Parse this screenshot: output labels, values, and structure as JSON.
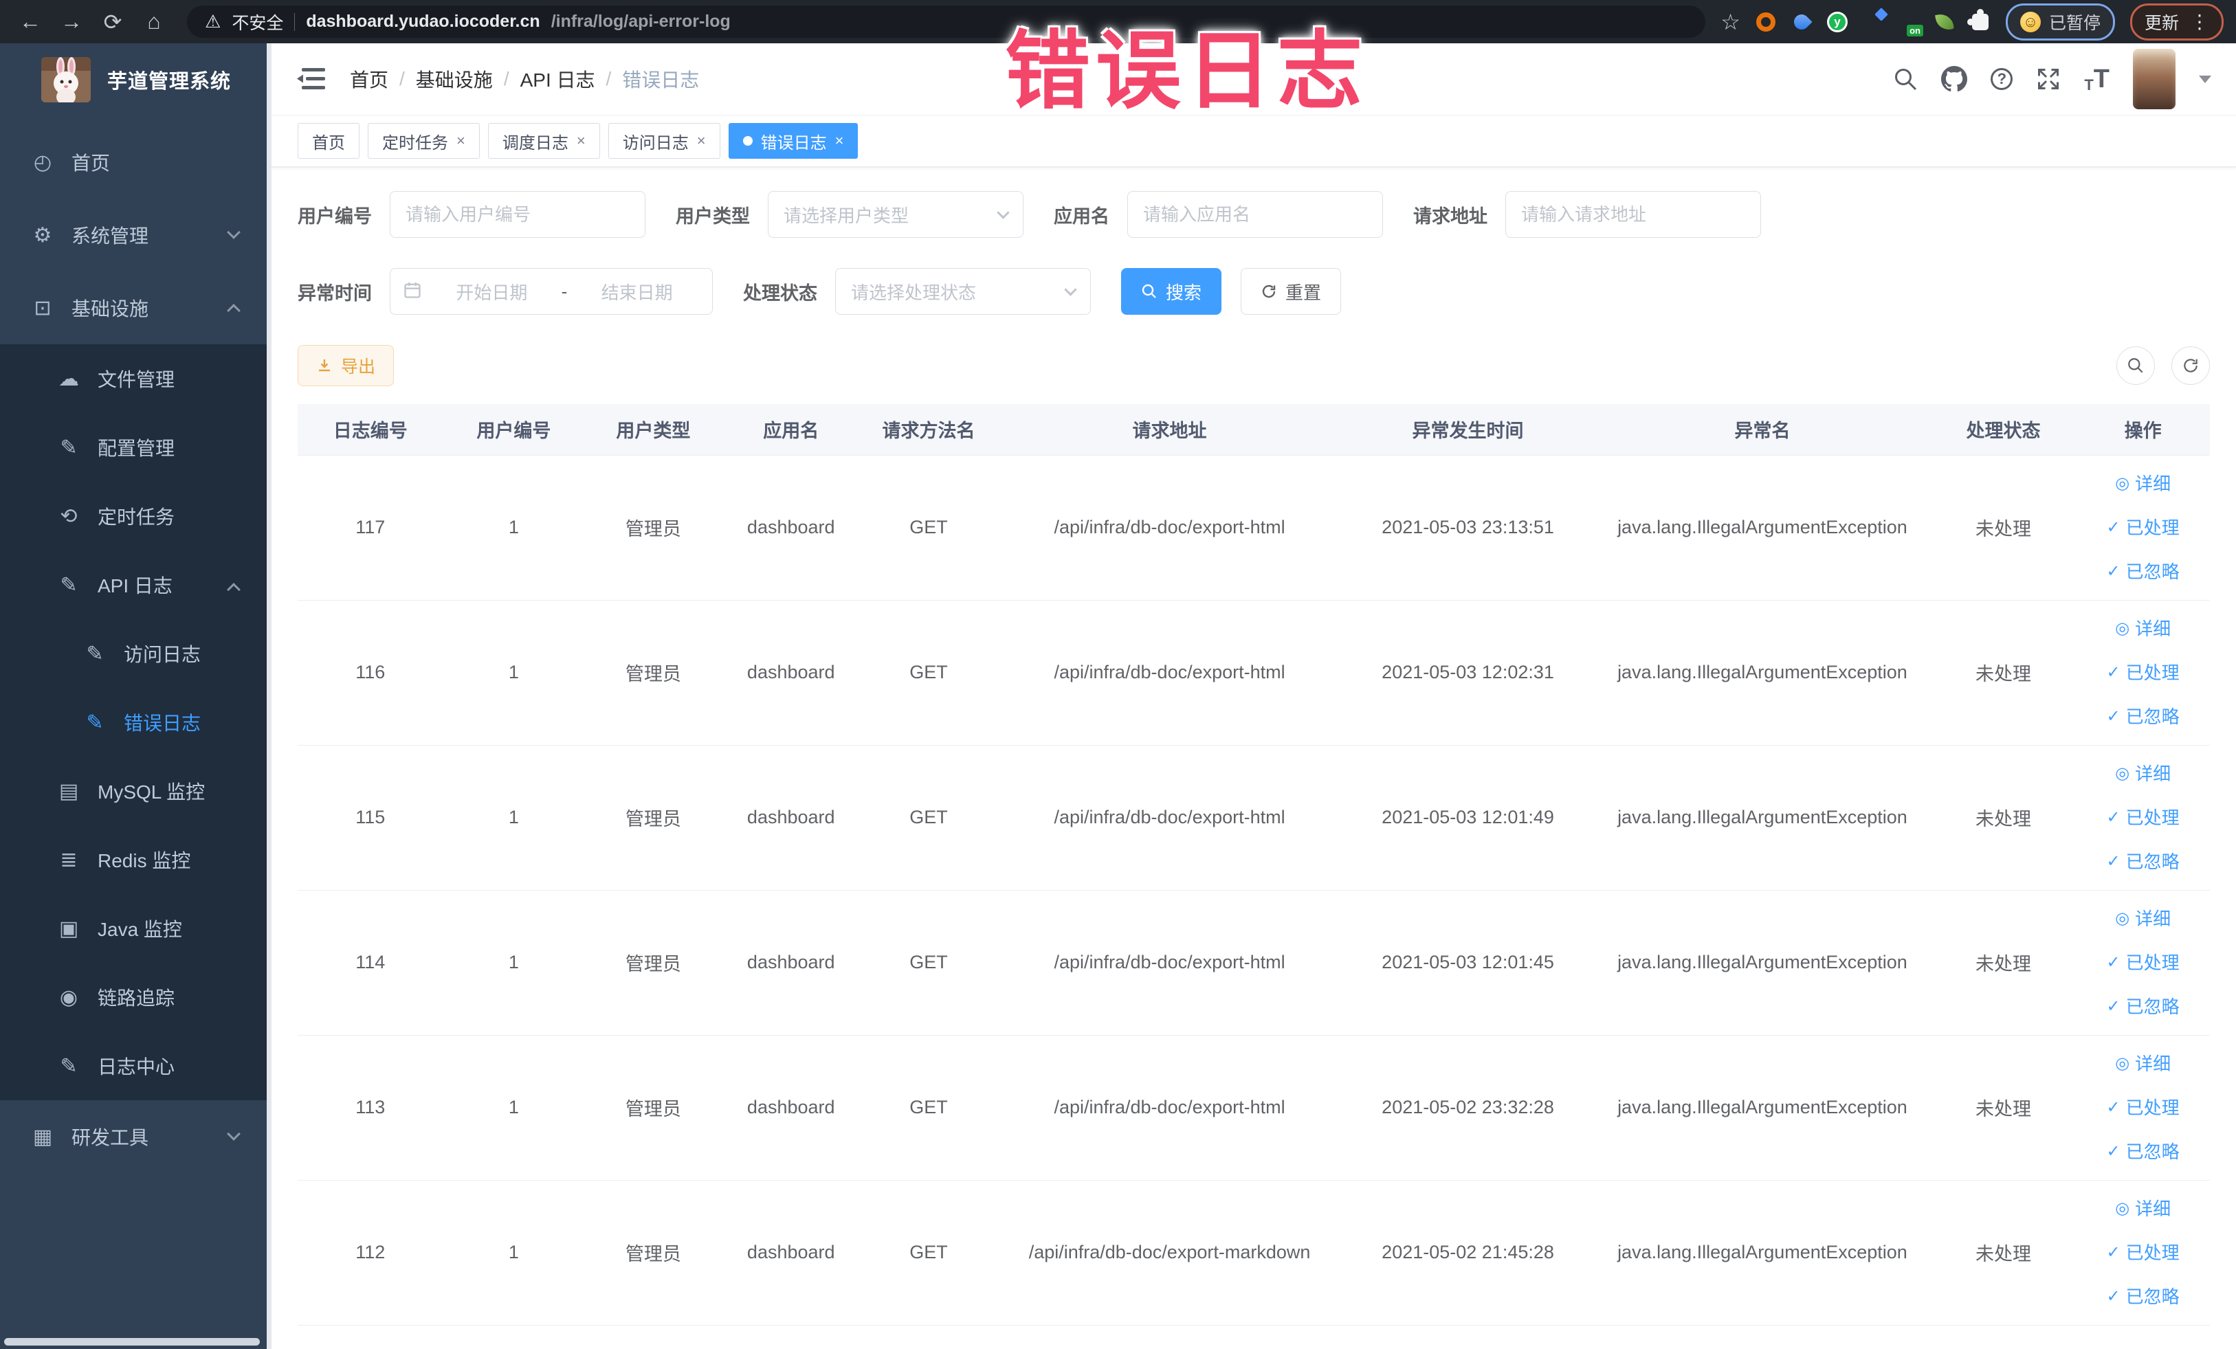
{
  "browser": {
    "security_label": "不安全",
    "url_host": "dashboard.yudao.iocoder.cn",
    "url_path": "/infra/log/api-error-log",
    "ext_y_label": "y",
    "ext_on_label": "on",
    "paused_label": "已暂停",
    "update_label": "更新"
  },
  "overlay": {
    "stamp": "错误日志"
  },
  "sidebar": {
    "title": "芋道管理系统",
    "menu": [
      {
        "id": "home",
        "label": "首页",
        "icon": "dashboard-icon",
        "level": 1
      },
      {
        "id": "system",
        "label": "系统管理",
        "icon": "gear-icon",
        "level": 1,
        "chevron": "down"
      },
      {
        "id": "infra",
        "label": "基础设施",
        "icon": "monitor-icon",
        "level": 1,
        "chevron": "up"
      },
      {
        "id": "file",
        "label": "文件管理",
        "icon": "cloud-upload-icon",
        "level": 2,
        "dark": true
      },
      {
        "id": "config",
        "label": "配置管理",
        "icon": "edit-icon",
        "level": 2,
        "dark": true
      },
      {
        "id": "job",
        "label": "定时任务",
        "icon": "history-icon",
        "level": 2,
        "dark": true
      },
      {
        "id": "api-log",
        "label": "API 日志",
        "icon": "edit-note-icon",
        "level": 2,
        "dark": true,
        "chevron": "up"
      },
      {
        "id": "access-log",
        "label": "访问日志",
        "icon": "edit-note-icon",
        "level": 3,
        "dark": true
      },
      {
        "id": "error-log",
        "label": "错误日志",
        "icon": "edit-note-icon",
        "level": 3,
        "dark": true,
        "active": true
      },
      {
        "id": "mysql",
        "label": "MySQL 监控",
        "icon": "chart-icon",
        "level": 2,
        "dark": true
      },
      {
        "id": "redis",
        "label": "Redis 监控",
        "icon": "layers-icon",
        "level": 2,
        "dark": true
      },
      {
        "id": "java",
        "label": "Java 监控",
        "icon": "screen-icon",
        "level": 2,
        "dark": true
      },
      {
        "id": "trace",
        "label": "链路追踪",
        "icon": "eye-icon",
        "level": 2,
        "dark": true
      },
      {
        "id": "log-center",
        "label": "日志中心",
        "icon": "edit-note-icon",
        "level": 2,
        "dark": true
      },
      {
        "id": "dev-tools",
        "label": "研发工具",
        "icon": "briefcase-icon",
        "level": 1,
        "chevron": "down"
      }
    ]
  },
  "icons": {
    "dashboard-icon": "◴",
    "gear-icon": "⚙",
    "monitor-icon": "⊡",
    "cloud-upload-icon": "☁",
    "edit-icon": "✎",
    "history-icon": "⟲",
    "edit-note-icon": "✎",
    "chart-icon": "▤",
    "layers-icon": "≣",
    "screen-icon": "▣",
    "eye-icon": "◉",
    "briefcase-icon": "▦"
  },
  "header": {
    "breadcrumb": [
      "首页",
      "基础设施",
      "API 日志",
      "错误日志"
    ]
  },
  "tabs": [
    {
      "id": "home",
      "label": "首页",
      "closable": false,
      "active": false
    },
    {
      "id": "job",
      "label": "定时任务",
      "closable": true,
      "active": false
    },
    {
      "id": "job-log",
      "label": "调度日志",
      "closable": true,
      "active": false
    },
    {
      "id": "api-access",
      "label": "访问日志",
      "closable": true,
      "active": false
    },
    {
      "id": "api-error",
      "label": "错误日志",
      "closable": true,
      "active": true
    }
  ],
  "filters": {
    "user_id": {
      "label": "用户编号",
      "placeholder": "请输入用户编号"
    },
    "user_type": {
      "label": "用户类型",
      "placeholder": "请选择用户类型"
    },
    "app_name": {
      "label": "应用名",
      "placeholder": "请输入应用名"
    },
    "request_url": {
      "label": "请求地址",
      "placeholder": "请输入请求地址"
    },
    "exception_time": {
      "label": "异常时间",
      "start_placeholder": "开始日期",
      "separator": "-",
      "end_placeholder": "结束日期"
    },
    "process_status": {
      "label": "处理状态",
      "placeholder": "请选择处理状态"
    },
    "search_label": "搜索",
    "reset_label": "重置"
  },
  "toolbar": {
    "export_label": "导出"
  },
  "table": {
    "columns": [
      "日志编号",
      "用户编号",
      "用户类型",
      "应用名",
      "请求方法名",
      "请求地址",
      "异常发生时间",
      "异常名",
      "处理状态",
      "操作"
    ],
    "rows": [
      {
        "cells": [
          "117",
          "1",
          "管理员",
          "dashboard",
          "GET",
          "/api/infra/db-doc/export-html",
          "2021-05-03 23:13:51",
          "java.lang.IllegalArgumentException",
          "未处理"
        ]
      },
      {
        "cells": [
          "116",
          "1",
          "管理员",
          "dashboard",
          "GET",
          "/api/infra/db-doc/export-html",
          "2021-05-03 12:02:31",
          "java.lang.IllegalArgumentException",
          "未处理"
        ]
      },
      {
        "cells": [
          "115",
          "1",
          "管理员",
          "dashboard",
          "GET",
          "/api/infra/db-doc/export-html",
          "2021-05-03 12:01:49",
          "java.lang.IllegalArgumentException",
          "未处理"
        ]
      },
      {
        "cells": [
          "114",
          "1",
          "管理员",
          "dashboard",
          "GET",
          "/api/infra/db-doc/export-html",
          "2021-05-03 12:01:45",
          "java.lang.IllegalArgumentException",
          "未处理"
        ]
      },
      {
        "cells": [
          "113",
          "1",
          "管理员",
          "dashboard",
          "GET",
          "/api/infra/db-doc/export-html",
          "2021-05-02 23:32:28",
          "java.lang.IllegalArgumentException",
          "未处理"
        ]
      },
      {
        "cells": [
          "112",
          "1",
          "管理员",
          "dashboard",
          "GET",
          "/api/infra/db-doc/export-markdown",
          "2021-05-02 21:45:28",
          "java.lang.IllegalArgumentException",
          "未处理"
        ]
      }
    ],
    "row_actions": [
      {
        "label": "详细",
        "icon": "detail-eye-icon",
        "glyph": "◎"
      },
      {
        "label": "已处理",
        "icon": "check-icon",
        "glyph": "✓"
      },
      {
        "label": "已忽略",
        "icon": "check-icon",
        "glyph": "✓"
      }
    ]
  }
}
